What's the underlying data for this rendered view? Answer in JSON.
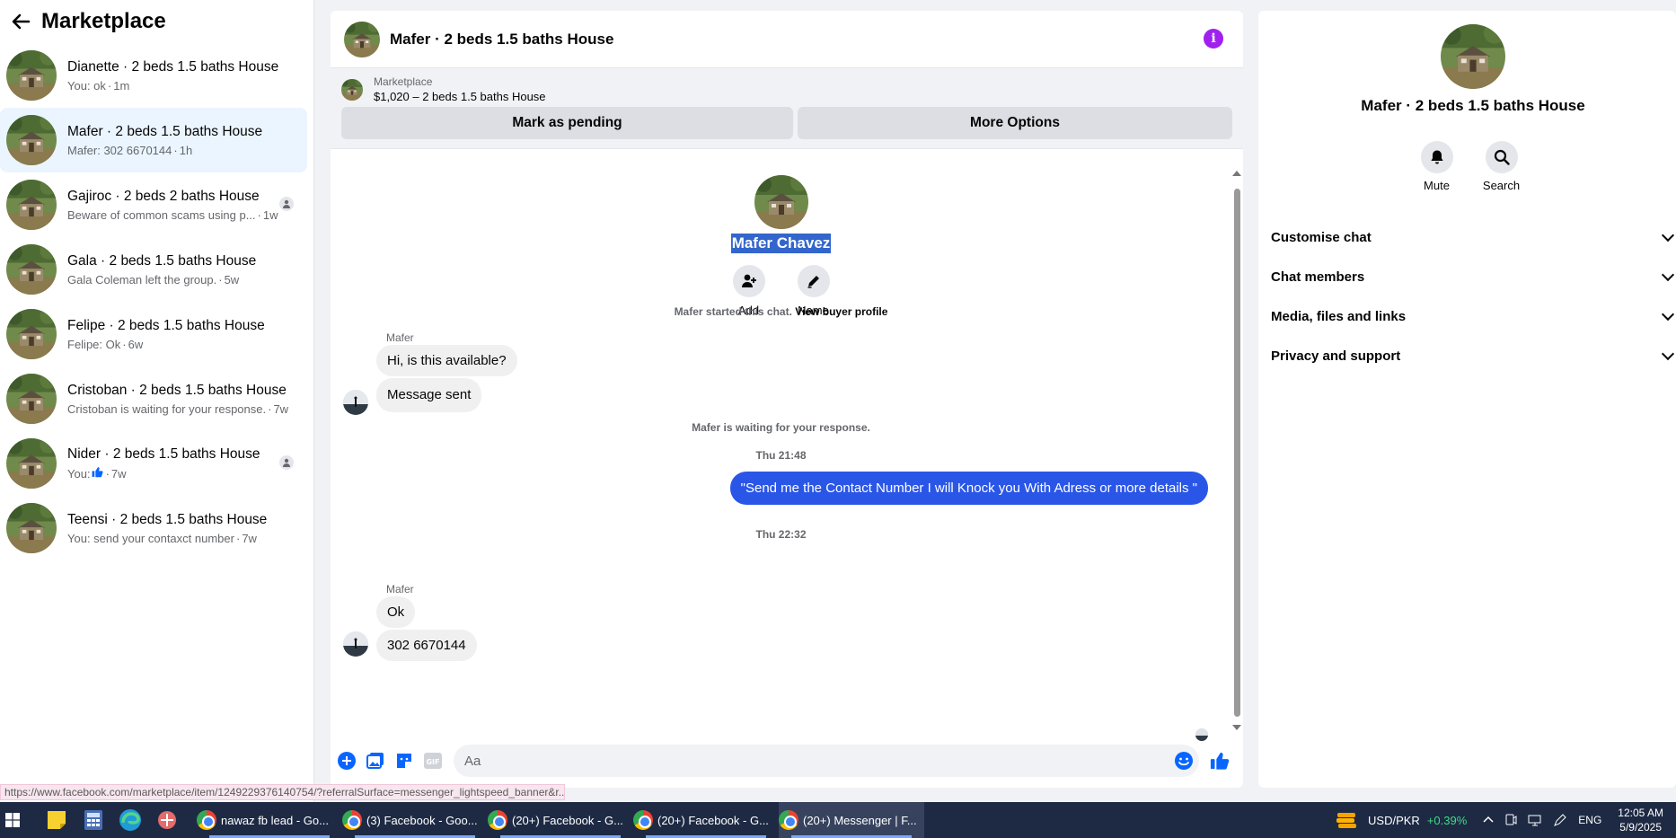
{
  "sidebar": {
    "title": "Marketplace",
    "conversations": [
      {
        "title": "Dianette · 2 beds 1.5 baths House",
        "preview": "You: ok",
        "time": "1m",
        "badge": false,
        "active": false
      },
      {
        "title": "Mafer · 2 beds 1.5 baths House",
        "preview": "Mafer: 302 6670144",
        "time": "1h",
        "badge": false,
        "active": true
      },
      {
        "title": "Gajiroc · 2 beds 2 baths House",
        "preview": "Beware of common scams using p...",
        "time": "1w",
        "badge": true,
        "active": false
      },
      {
        "title": "Gala · 2 beds 1.5 baths House",
        "preview": "Gala Coleman left the group.",
        "time": "5w",
        "badge": false,
        "active": false
      },
      {
        "title": "Felipe · 2 beds 1.5 baths House",
        "preview": "Felipe: Ok",
        "time": "6w",
        "badge": false,
        "active": false
      },
      {
        "title": "Cristoban · 2 beds 1.5 baths House",
        "preview": "Cristoban is waiting for your response.",
        "time": "7w",
        "badge": false,
        "active": false
      },
      {
        "title": "Nider · 2 beds 1.5 baths House",
        "preview": "You:",
        "time": "7w",
        "badge": true,
        "active": false,
        "thumb": true
      },
      {
        "title": "Teensi · 2 beds 1.5 baths House",
        "preview": "You: send your contaxct number",
        "time": "7w",
        "badge": false,
        "active": false
      }
    ]
  },
  "chat": {
    "header_title": "Mafer · 2 beds 1.5 baths House",
    "listing": {
      "source": "Marketplace",
      "price_line": "$1,020 – 2 beds 1.5 baths House",
      "pending_label": "Mark as pending",
      "more_label": "More Options"
    },
    "profile": {
      "name": "Mafer Chavez",
      "add_label": "Add",
      "name_label": "Name"
    },
    "started_text": "Mafer started this chat.",
    "view_profile_link": "View buyer profile",
    "waiting_text": "Mafer is waiting for your response.",
    "messages": {
      "sender1": "Mafer",
      "in1": "Hi, is this available?",
      "in2": "Message sent",
      "ts1": "Thu 21:48",
      "out1": "\"Send me the Contact Number I will Knock you With Adress or more details \"",
      "ts2": "Thu 22:32",
      "sender2": "Mafer",
      "in3": "Ok",
      "in4": "302 6670144"
    },
    "composer_placeholder": "Aa"
  },
  "right_panel": {
    "title": "Mafer · 2 beds 1.5 baths House",
    "mute_label": "Mute",
    "search_label": "Search",
    "sections": [
      "Customise chat",
      "Chat members",
      "Media, files and links",
      "Privacy and support"
    ]
  },
  "status_url": "https://www.facebook.com/marketplace/item/1249229376140754/?referralSurface=messenger_lightspeed_banner&r...",
  "taskbar": {
    "tasks": [
      "nawaz fb lead - Go...",
      "(3) Facebook - Goo...",
      "(20+) Facebook - G...",
      "(20+) Facebook - G...",
      "(20+) Messenger | F..."
    ],
    "fx_label": "USD/PKR",
    "fx_change": "+0.39%",
    "lang": "ENG",
    "time": "12:05 AM",
    "date": "5/9/2025"
  },
  "colors": {
    "accent_blue": "#2a56e8",
    "info_purple": "#a020f0",
    "active_bg": "#ebf5ff",
    "taskbar": "#1e2a44"
  }
}
